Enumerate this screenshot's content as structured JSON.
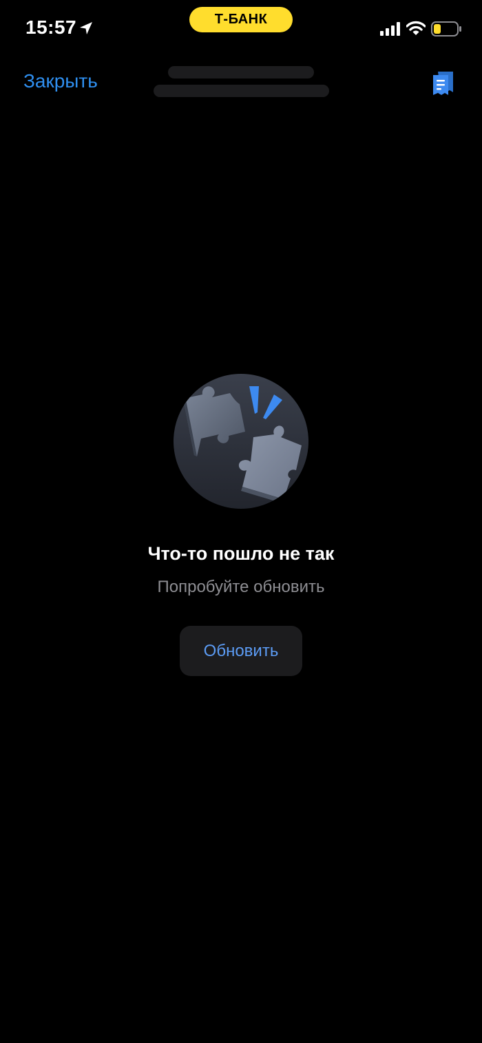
{
  "status_bar": {
    "time": "15:57",
    "brand": "Т-БАНК",
    "icons": [
      "location-arrow-icon",
      "cellular-signal-icon",
      "wifi-icon",
      "battery-low-icon"
    ]
  },
  "nav": {
    "close_label": "Закрыть",
    "right_icon": "receipt-icon"
  },
  "error": {
    "illustration": "broken-puzzle-icon",
    "title": "Что-то пошло не так",
    "subtitle": "Попробуйте обновить",
    "button_label": "Обновить"
  },
  "colors": {
    "background": "#000000",
    "accent_link": "#2f8ff0",
    "brand_yellow": "#ffdd2d",
    "button_bg": "#1c1c1e",
    "button_text": "#5c9cf5",
    "subtitle": "#8e8e93"
  }
}
